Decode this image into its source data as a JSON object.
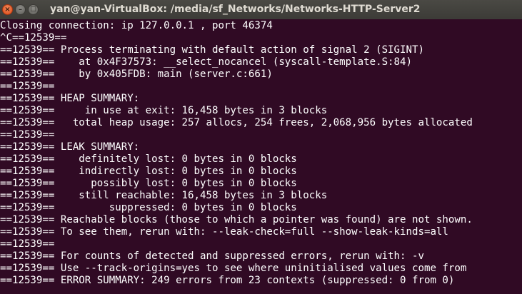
{
  "window": {
    "title": "yan@yan-VirtualBox: /media/sf_Networks/Networks-HTTP-Server2",
    "controls": {
      "close_glyph": "×",
      "minimize_glyph": "–",
      "maximize_glyph": "□",
      "close_icon": "close-icon",
      "minimize_icon": "minimize-icon",
      "maximize_icon": "maximize-icon"
    }
  },
  "colors": {
    "background": "#300a24",
    "text": "#ffffff",
    "titlebar": "#3c3b37",
    "close_button": "#df4a16"
  },
  "terminal": {
    "lines": [
      "Closing connection: ip 127.0.0.1 , port 46374",
      "^C==12539==",
      "==12539== Process terminating with default action of signal 2 (SIGINT)",
      "==12539==    at 0x4F37573: __select_nocancel (syscall-template.S:84)",
      "==12539==    by 0x405FDB: main (server.c:661)",
      "==12539==",
      "==12539== HEAP SUMMARY:",
      "==12539==     in use at exit: 16,458 bytes in 3 blocks",
      "==12539==   total heap usage: 257 allocs, 254 frees, 2,068,956 bytes allocated",
      "==12539==",
      "==12539== LEAK SUMMARY:",
      "==12539==    definitely lost: 0 bytes in 0 blocks",
      "==12539==    indirectly lost: 0 bytes in 0 blocks",
      "==12539==      possibly lost: 0 bytes in 0 blocks",
      "==12539==    still reachable: 16,458 bytes in 3 blocks",
      "==12539==         suppressed: 0 bytes in 0 blocks",
      "==12539== Reachable blocks (those to which a pointer was found) are not shown.",
      "==12539== To see them, rerun with: --leak-check=full --show-leak-kinds=all",
      "==12539==",
      "==12539== For counts of detected and suppressed errors, rerun with: -v",
      "==12539== Use --track-origins=yes to see where uninitialised values come from",
      "==12539== ERROR SUMMARY: 249 errors from 23 contexts (suppressed: 0 from 0)"
    ]
  }
}
